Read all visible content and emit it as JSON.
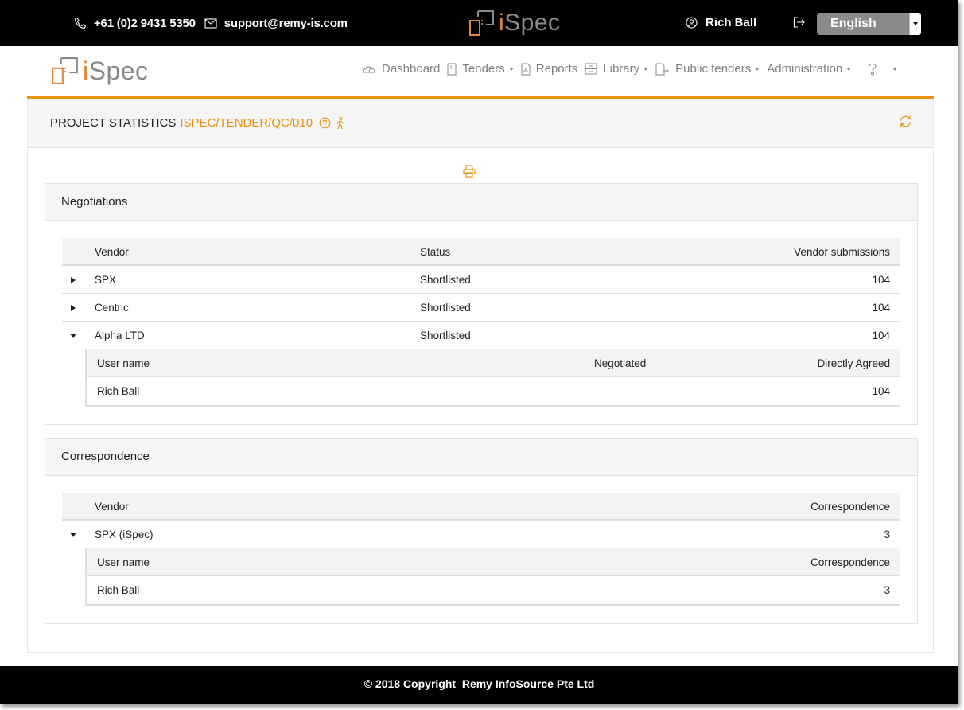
{
  "topbar": {
    "phone": "+61 (0)2 9431 5350",
    "email": "support@remy-is.com",
    "brand": "iSpec",
    "user_name": "Rich Ball",
    "language": "English"
  },
  "navbar": {
    "brand": "iSpec",
    "items": [
      {
        "label": "Dashboard",
        "icon": "dashboard-gauge-icon",
        "dropdown": false
      },
      {
        "label": "Tenders",
        "icon": "document-icon",
        "dropdown": true
      },
      {
        "label": "Reports",
        "icon": "report-chart-icon",
        "dropdown": false
      },
      {
        "label": "Library",
        "icon": "library-cabinet-icon",
        "dropdown": true
      },
      {
        "label": "Public tenders",
        "icon": "document-export-icon",
        "dropdown": true
      },
      {
        "label": "Administration",
        "icon": "",
        "dropdown": true
      }
    ],
    "help_icon": "question-icon"
  },
  "page": {
    "title": "PROJECT STATISTICS",
    "project_code": "ISPEC/TENDER/QC/010",
    "accent_color": "#e8930f"
  },
  "negotiations": {
    "title": "Negotiations",
    "columns": [
      "Vendor",
      "Status",
      "Vendor submissions"
    ],
    "rows": [
      {
        "vendor": "SPX",
        "status": "Shortlisted",
        "submissions": "104",
        "expanded": false
      },
      {
        "vendor": "Centric",
        "status": "Shortlisted",
        "submissions": "104",
        "expanded": false
      },
      {
        "vendor": "Alpha LTD",
        "status": "Shortlisted",
        "submissions": "104",
        "expanded": true
      }
    ],
    "sub_table": {
      "columns": [
        "User name",
        "Negotiated",
        "Directly Agreed"
      ],
      "rows": [
        {
          "user": "Rich Ball",
          "negotiated": "",
          "directly_agreed": "104"
        }
      ]
    }
  },
  "correspondence": {
    "title": "Correspondence",
    "columns": [
      "Vendor",
      "Correspondence"
    ],
    "rows": [
      {
        "vendor": "SPX (iSpec)",
        "count": "3",
        "expanded": true
      }
    ],
    "sub_table": {
      "columns": [
        "User name",
        "Correspondence"
      ],
      "rows": [
        {
          "user": "Rich Ball",
          "count": "3"
        }
      ]
    }
  },
  "footer": {
    "text": "© 2018 Copyright  Remy InfoSource Pte Ltd"
  }
}
